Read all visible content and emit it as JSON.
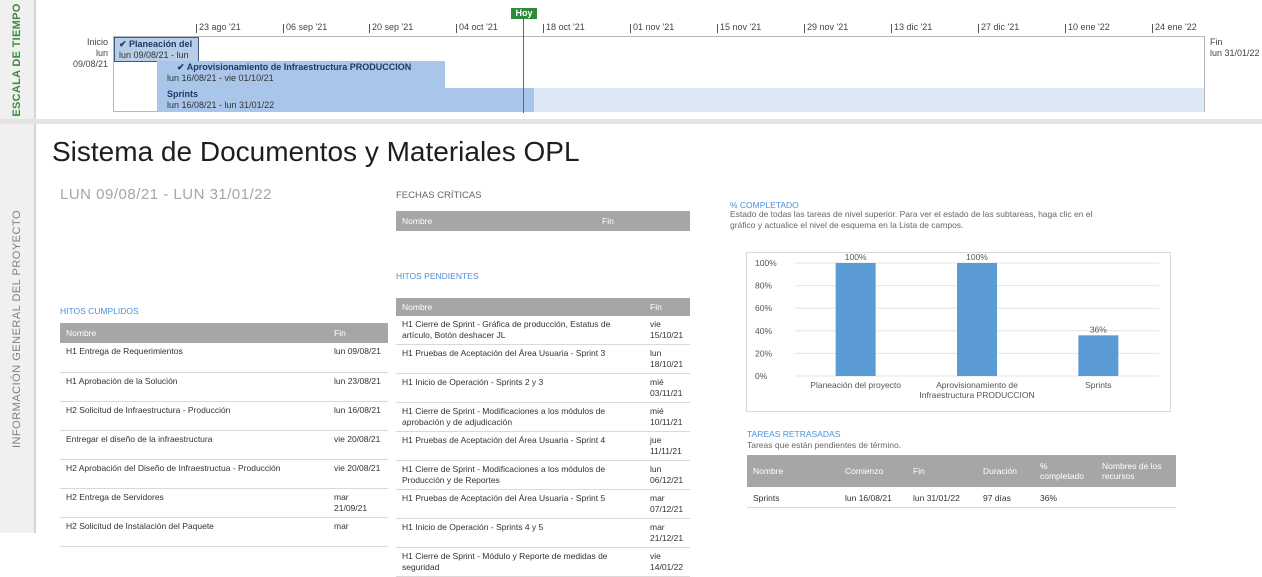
{
  "timeline": {
    "side_label": "ESCALA DE TIEMPO",
    "today_label": "Hoy",
    "ticks": [
      "23 ago '21",
      "06 sep '21",
      "20 sep '21",
      "04 oct '21",
      "18 oct '21",
      "01 nov '21",
      "15 nov '21",
      "29 nov '21",
      "13 dic '21",
      "27 dic '21",
      "10 ene '22",
      "24 ene '22"
    ],
    "start_label": "Inicio",
    "start_date": "lun 09/08/21",
    "end_label": "Fin",
    "end_date": "lun 31/01/22",
    "tasks": [
      {
        "name": "✔ Planeación del",
        "dates": "lun 09/08/21 - lun"
      },
      {
        "name": "✔ Aprovisionamiento de Infraestructura PRODUCCION",
        "dates": "lun 16/08/21 - vie 01/10/21"
      },
      {
        "name": "Sprints",
        "dates": "lun 16/08/21 - lun 31/01/22"
      }
    ]
  },
  "project": {
    "side_label": "INFORMACIÓN GENERAL DEL PROYECTO",
    "title": "Sistema de Documentos y Materiales OPL",
    "date_range": "LUN 09/08/21 -  LUN 31/01/22"
  },
  "hitos_cumplidos": {
    "label": "HITOS CUMPLIDOS",
    "headers": [
      "Nombre",
      "Fin"
    ],
    "rows": [
      [
        "H1 Entrega de Requerimientos",
        "lun 09/08/21"
      ],
      [
        "H1 Aprobación de la Solución",
        "lun 23/08/21"
      ],
      [
        "H2 Solicitud de Infraestructura - Producción",
        "lun 16/08/21"
      ],
      [
        "Entregar el diseño de la infraestructura",
        "vie 20/08/21"
      ],
      [
        "H2 Aprobación del Diseño de Infraestructua - Producción",
        "vie 20/08/21"
      ],
      [
        "H2 Entrega de Servidores",
        "mar 21/09/21"
      ],
      [
        "H2 Solicitud de Instalación del Paquete",
        "mar"
      ]
    ]
  },
  "fechas_criticas": {
    "label": "FECHAS CRÍTICAS",
    "headers": [
      "Nombre",
      "Fin"
    ]
  },
  "hitos_pendientes": {
    "label": "HITOS PENDIENTES",
    "headers": [
      "Nombre",
      "Fin"
    ],
    "rows": [
      [
        "H1 Cierre de Sprint - Gráfica de producción, Estatus de artículo, Botón deshacer JL",
        "vie 15/10/21"
      ],
      [
        "H1 Pruebas de Aceptación del Área Usuaria - Sprint 3",
        "lun 18/10/21"
      ],
      [
        "H1 Inicio de Operación - Sprints 2 y 3",
        "mié 03/11/21"
      ],
      [
        "H1 Cierre de Sprint - Modificaciones a los módulos de aprobación y de adjudicación",
        "mié 10/11/21"
      ],
      [
        "H1 Pruebas de Aceptación del Área Usuaria - Sprint 4",
        "jue 11/11/21"
      ],
      [
        "H1 Cierre de Sprint - Modificaciones a los módulos de Producción y de Reportes",
        "lun 06/12/21"
      ],
      [
        "H1 Pruebas de Aceptación del Área Usuaria - Sprint 5",
        "mar 07/12/21"
      ],
      [
        "H1 Inicio de Operación - Sprints 4 y 5",
        "mar 21/12/21"
      ],
      [
        "H1 Cierre de Sprint - Módulo y Reporte de medidas de seguridad",
        "vie 14/01/22"
      ]
    ]
  },
  "completado": {
    "label": "% COMPLETADO",
    "description": "Estado de todas las tareas de nivel superior. Para ver el estado de las subtareas, haga clic en el gráfico y actualice el nivel de esquema en la Lista de campos."
  },
  "chart_data": {
    "type": "bar",
    "categories": [
      "Planeación del proyecto",
      "Aprovisionamiento de Infraestructura PRODUCCION",
      "Sprints"
    ],
    "values": [
      100,
      100,
      36
    ],
    "data_labels": [
      "100%",
      "100%",
      "36%"
    ],
    "ylim": [
      0,
      100
    ],
    "yticks": [
      "0%",
      "20%",
      "40%",
      "60%",
      "80%",
      "100%"
    ],
    "color": "#5b9bd5",
    "grid": true
  },
  "tareas_retrasadas": {
    "label": "TAREAS RETRASADAS",
    "subtitle": "Tareas que están pendientes de término.",
    "headers": [
      "Nombre",
      "Comienzo",
      "Fin",
      "Duración",
      "% completado",
      "Nombres de los recursos"
    ],
    "rows": [
      [
        "Sprints",
        "lun 16/08/21",
        "lun 31/01/22",
        "97 días",
        "36%",
        ""
      ]
    ]
  }
}
